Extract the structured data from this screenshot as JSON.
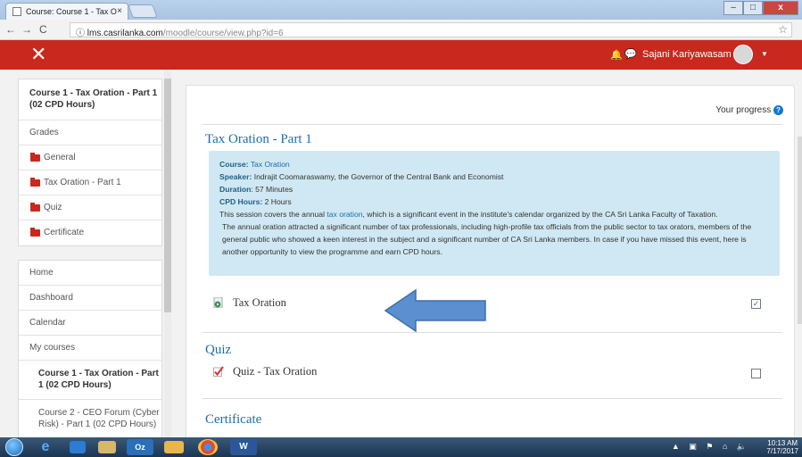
{
  "browser": {
    "tab_title": "Course: Course 1 - Tax O",
    "tab_close": "×",
    "url_host": "lms.casrilanka.com",
    "url_path": "/moodle/course/view.php?id=6",
    "back": "←",
    "forward": "→",
    "reload": "C",
    "info": "ⓘ",
    "star": "☆",
    "win_min": "–",
    "win_max": "□",
    "win_close": "x"
  },
  "navbar": {
    "close_glyph": "✕",
    "bell_glyph": "🔔",
    "chat_glyph": "💬",
    "user_name": "Sajani Kariyawasam",
    "caret": "▼",
    "color": "#c8281e"
  },
  "drawer": {
    "course_title": "Course 1 - Tax Oration - Part 1 (02 CPD Hours)",
    "items": [
      {
        "label": "Grades"
      },
      {
        "label": "General",
        "icon": "folder-icon"
      },
      {
        "label": "Tax Oration - Part 1",
        "icon": "folder-icon"
      },
      {
        "label": "Quiz",
        "icon": "folder-icon"
      },
      {
        "label": "Certificate",
        "icon": "folder-icon"
      }
    ],
    "nav": [
      {
        "label": "Home"
      },
      {
        "label": "Dashboard"
      },
      {
        "label": "Calendar"
      },
      {
        "label": "My courses"
      }
    ],
    "courses": [
      {
        "label": "Course 1 - Tax Oration - Part 1 (02 CPD Hours)"
      },
      {
        "label": "Course 2 - CEO Forum (Cyber Risk) - Part 1 (02 CPD Hours)"
      }
    ]
  },
  "main": {
    "your_progress": "Your progress",
    "help_glyph": "?",
    "section1": {
      "title": "Tax Oration - Part 1",
      "course_label": "Course:",
      "course_value": "Tax Oration",
      "speaker_label": "Speaker:",
      "speaker_value": "Indrajit Coomaraswamy, the Governor of the Central Bank and Economist",
      "duration_label": "Duration",
      "duration_value": ": 57 Minutes",
      "cpd_label": "CPD Hours:",
      "cpd_value": "2 Hours",
      "para1_a": "This session covers the annual ",
      "para1_link": "tax oration",
      "para1_b": ", which is a significant event in the institute's calendar organized by the CA Sri Lanka Faculty of Taxation.",
      "para2": "The annual oration attracted a significant number of tax professionals, including high-profile tax officials from the public sector to tax orators, members of the general public who showed a keen interest in the subject and a significant number of CA Sri Lanka members. In case if you have missed this event, here is another opportunity to view the programme and earn CPD hours.",
      "activity": "Tax Oration",
      "activity_icon": "video-file-icon",
      "activity_check": "✓"
    },
    "section2": {
      "title": "Quiz",
      "activity": "Quiz - Tax Oration",
      "activity_icon": "quiz-icon",
      "activity_check": ""
    },
    "section3": {
      "title": "Certificate"
    }
  },
  "taskbar": {
    "tray": "▲ ▣ ⚑ ⌂ 🔈",
    "time": "10:13 AM",
    "date": "7/17/2017"
  }
}
